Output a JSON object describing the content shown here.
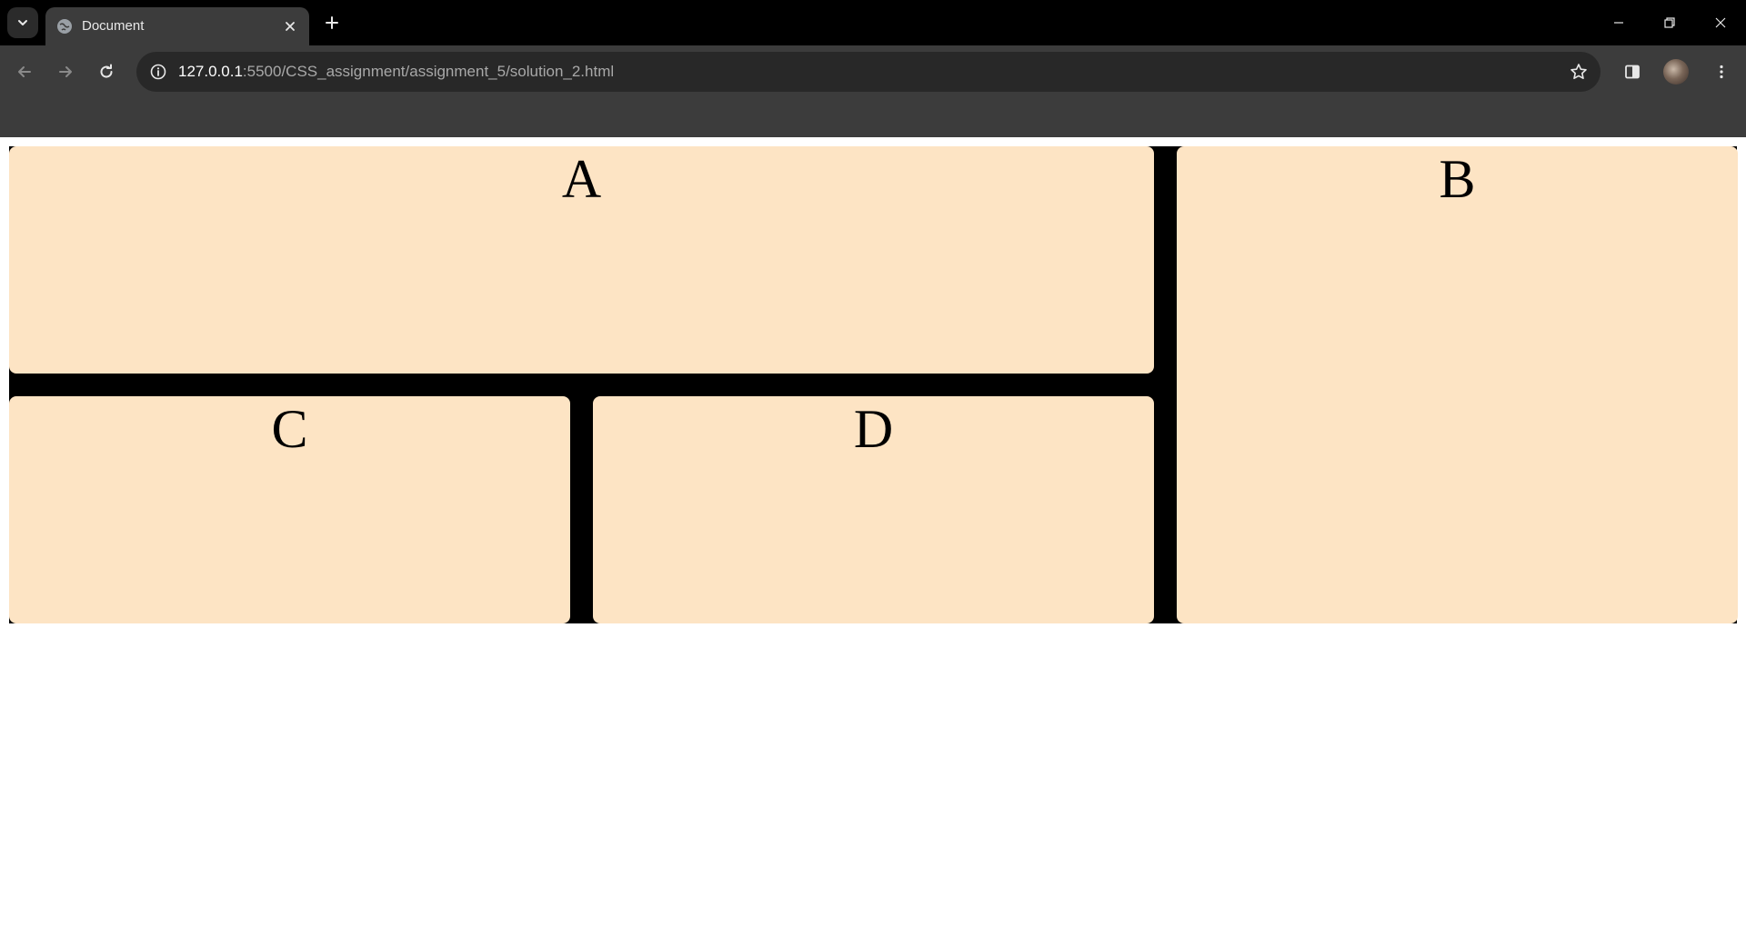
{
  "browser": {
    "tab": {
      "title": "Document"
    },
    "address_bar": {
      "url_host": "127.0.0.1",
      "url_path": ":5500/CSS_assignment/assignment_5/solution_2.html"
    },
    "icons": {
      "tab_search": "chevron-down-icon",
      "favicon": "globe-icon",
      "tab_close": "close-icon",
      "new_tab": "plus-icon",
      "back": "arrow-left-icon",
      "forward": "arrow-right-icon",
      "reload": "reload-icon",
      "site_info": "info-icon",
      "bookmark": "star-icon",
      "side_panel": "side-panel-icon",
      "menu": "kebab-menu-icon",
      "minimize": "minimize-icon",
      "restore": "restore-icon",
      "close_window": "close-icon"
    },
    "colors": {
      "frame": "#000000",
      "toolbar": "#3c3c3c",
      "omnibox": "#282828"
    }
  },
  "page": {
    "boxes": {
      "a": "A",
      "b": "B",
      "c": "C",
      "d": "D"
    },
    "colors": {
      "box_background": "#fde4c4",
      "grid_background": "#000000"
    }
  }
}
